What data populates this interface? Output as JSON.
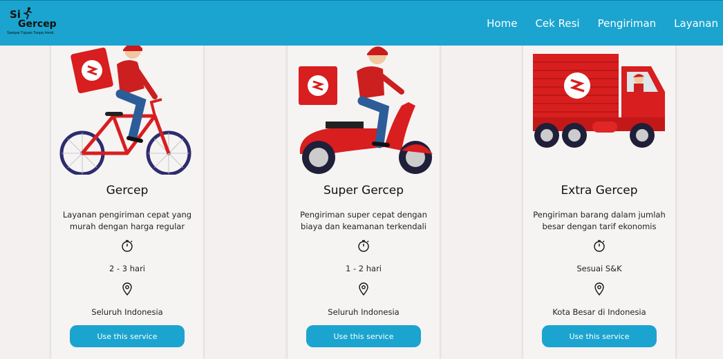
{
  "brand": {
    "line1": "Si",
    "line2": "Gercep",
    "tagline": "Sampai Tujuan Tanpa Henti"
  },
  "nav": {
    "items": [
      {
        "label": "Home"
      },
      {
        "label": "Cek Resi"
      },
      {
        "label": "Pengiriman"
      },
      {
        "label": "Layanan"
      }
    ]
  },
  "colors": {
    "navbar": "#1ba4cf",
    "button": "#1ba4cf",
    "brand_red": "#d81e1e",
    "background": "#f4f0f0"
  },
  "services": [
    {
      "illustration": "bicycle-courier",
      "title": "Gercep",
      "description": "Layanan pengiriman cepat yang murah dengan harga regular",
      "duration": "2 - 3 hari",
      "coverage": "Seluruh Indonesia",
      "button": "Use this service"
    },
    {
      "illustration": "scooter-courier",
      "title": "Super Gercep",
      "description": "Pengiriman super cepat dengan biaya dan keamanan terkendali",
      "duration": "1 - 2 hari",
      "coverage": "Seluruh Indonesia",
      "button": "Use this service"
    },
    {
      "illustration": "delivery-truck",
      "title": "Extra Gercep",
      "description": "Pengiriman barang dalam jumlah besar dengan tarif ekonomis",
      "duration": "Sesuai S&K",
      "coverage": "Kota Besar di Indonesia",
      "button": "Use this service"
    }
  ]
}
